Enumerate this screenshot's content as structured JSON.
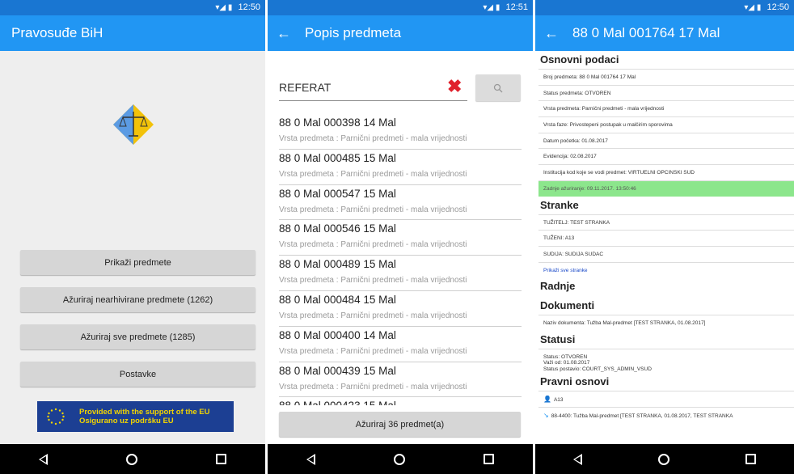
{
  "status_bar": {
    "time1": "12:50",
    "time2": "12:51",
    "time3": "12:50"
  },
  "screen1": {
    "app_title": "Pravosuđe BiH",
    "buttons": [
      "Prikaži predmete",
      "Ažuriraj nearhivirane predmete (1262)",
      "Ažuriraj sve predmete (1285)",
      "Postavke"
    ],
    "eu_banner": {
      "line1": "Provided with the support of the EU",
      "line2": "Osigurano uz podršku EU"
    }
  },
  "screen2": {
    "title": "Popis predmeta",
    "search_value": "REFERAT",
    "items": [
      {
        "num": "88 0 Mal 000398 14 Mal",
        "type": "Vrsta predmeta : Parnični predmeti - mala vrijednosti"
      },
      {
        "num": "88 0 Mal 000485 15 Mal",
        "type": "Vrsta predmeta : Parnični predmeti - mala vrijednosti"
      },
      {
        "num": "88 0 Mal 000547 15 Mal",
        "type": "Vrsta predmeta : Parnični predmeti - mala vrijednosti"
      },
      {
        "num": "88 0 Mal 000546 15 Mal",
        "type": "Vrsta predmeta : Parnični predmeti - mala vrijednosti"
      },
      {
        "num": "88 0 Mal 000489 15 Mal",
        "type": "Vrsta predmeta : Parnični predmeti - mala vrijednosti"
      },
      {
        "num": "88 0 Mal 000484 15 Mal",
        "type": "Vrsta predmeta : Parnični predmeti - mala vrijednosti"
      },
      {
        "num": "88 0 Mal 000400 14 Mal",
        "type": "Vrsta predmeta : Parnični predmeti - mala vrijednosti"
      },
      {
        "num": "88 0 Mal 000439 15 Mal",
        "type": "Vrsta predmeta : Parnični predmeti - mala vrijednosti"
      }
    ],
    "partial_item": "88 0 Mal 000423 15 Mal",
    "update_button": "Ažuriraj 36 predmet(a)"
  },
  "screen3": {
    "title": "88 0 Mal 001764 17 Mal",
    "sections": {
      "osnovni": "Osnovni podaci",
      "stranke": "Stranke",
      "radnje": "Radnje",
      "dokumenti": "Dokumenti",
      "statusi": "Statusi",
      "pravni": "Pravni osnovi"
    },
    "osnovni_rows": [
      "Broj predmeta: 88 0 Mal 001764 17 Mal",
      "Status predmeta: OTVOREN",
      "Vrsta predmeta: Parnični predmeti - mala vrijednosti",
      "Vrsta faze: Privostepeni postupak u malčirim sporovima",
      "Datum početka: 01.08.2017",
      "Evidencija: 02.08.2017",
      "Institucija kod koje se vodi predmet: VIRTUELNI OPCINSKI SUD"
    ],
    "last_update": "Zadnje ažuriranje: 09.11.2017. 13:50:46",
    "stranke_rows": [
      "TUŽITELJ: TEST STRANKA",
      "TUŽENI: A13",
      "SUDIJA: SUDIJA SUDAC"
    ],
    "stranke_link": "Prikaži sve stranke",
    "dokument_row": "Naziv dokumenta: Tužba Mal-predmet [TEST STRANKA, 01.08.2017]",
    "status_lines": [
      "Status: OTVOREN",
      "Važi od: 01.08.2017",
      "Status postavio: COURT_SYS_ADMIN_VSUD"
    ],
    "pravni_rows": [
      "A13",
      "88-4400: Tužba Mal-predmet [TEST STRANKA, 01.08.2017, TEST STRANKA"
    ]
  },
  "colors": {
    "appbar": "#2196f3",
    "statusbar": "#1976d2",
    "highlight": "#8ce68c",
    "clear": "#e0202b",
    "eu_blue": "#1c3f93",
    "eu_yellow": "#f2d400"
  }
}
